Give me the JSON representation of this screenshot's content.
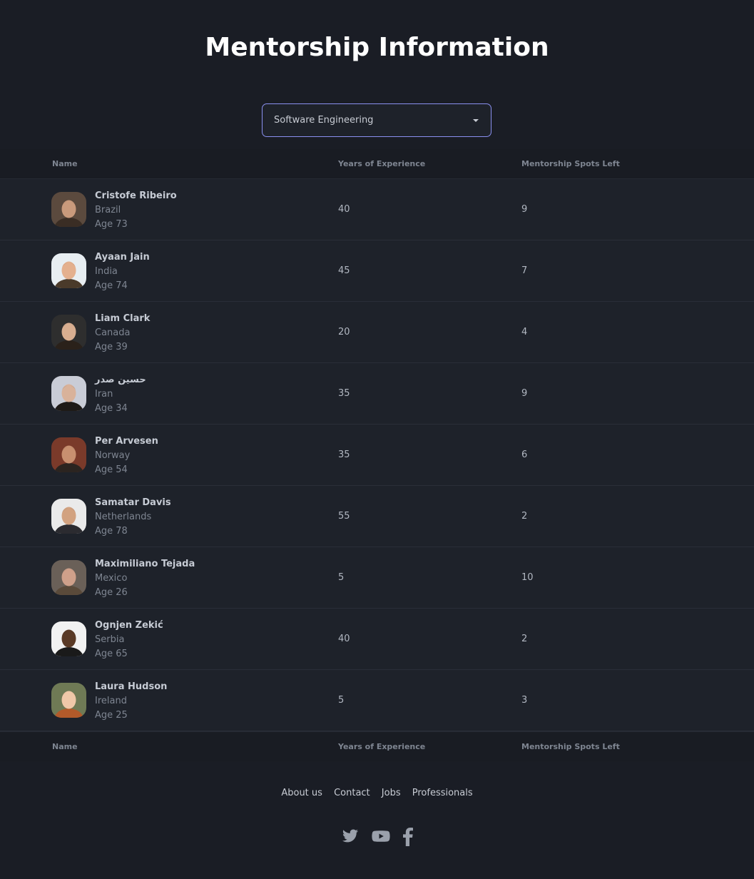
{
  "page": {
    "title": "Mentorship Information"
  },
  "filter": {
    "selected": "Software Engineering"
  },
  "table": {
    "headers": {
      "name": "Name",
      "experience": "Years of Experience",
      "spots": "Mentorship Spots Left"
    },
    "rows": [
      {
        "name": "Cristofe Ribeiro",
        "country": "Brazil",
        "age": "Age 73",
        "experience": "40",
        "spots": "9"
      },
      {
        "name": "Ayaan Jain",
        "country": "India",
        "age": "Age 74",
        "experience": "45",
        "spots": "7"
      },
      {
        "name": "Liam Clark",
        "country": "Canada",
        "age": "Age 39",
        "experience": "20",
        "spots": "4"
      },
      {
        "name": "حسين صدر",
        "country": "Iran",
        "age": "Age 34",
        "experience": "35",
        "spots": "9"
      },
      {
        "name": "Per Arvesen",
        "country": "Norway",
        "age": "Age 54",
        "experience": "35",
        "spots": "6"
      },
      {
        "name": "Samatar Davis",
        "country": "Netherlands",
        "age": "Age 78",
        "experience": "55",
        "spots": "2"
      },
      {
        "name": "Maximiliano Tejada",
        "country": "Mexico",
        "age": "Age 26",
        "experience": "5",
        "spots": "10"
      },
      {
        "name": "Ognjen Zekić",
        "country": "Serbia",
        "age": "Age 65",
        "experience": "40",
        "spots": "2"
      },
      {
        "name": "Laura Hudson",
        "country": "Ireland",
        "age": "Age 25",
        "experience": "5",
        "spots": "3"
      }
    ]
  },
  "footer": {
    "links": [
      "About us",
      "Contact",
      "Jobs",
      "Professionals"
    ],
    "social_icons": [
      "twitter-icon",
      "youtube-icon",
      "facebook-icon"
    ]
  },
  "colors": {
    "background": "#1a1d25",
    "row_background": "#1e222a",
    "accent_border": "#8a90f0"
  }
}
